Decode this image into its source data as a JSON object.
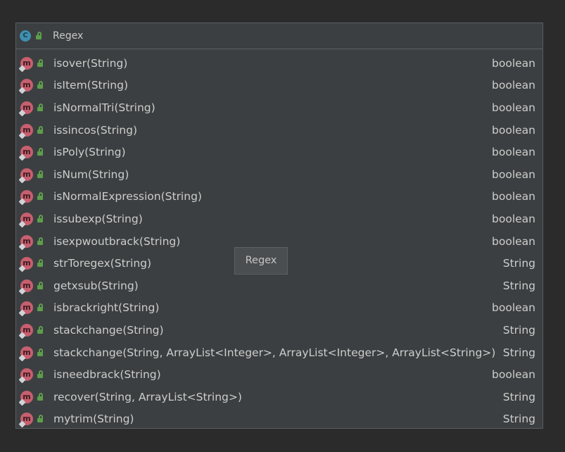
{
  "class": {
    "icon_letter": "C",
    "name": "Regex"
  },
  "tooltip": "Regex",
  "methods": [
    {
      "name": "isover(String)",
      "type": "boolean"
    },
    {
      "name": "isItem(String)",
      "type": "boolean"
    },
    {
      "name": "isNormalTri(String)",
      "type": "boolean"
    },
    {
      "name": "issincos(String)",
      "type": "boolean"
    },
    {
      "name": "isPoly(String)",
      "type": "boolean"
    },
    {
      "name": "isNum(String)",
      "type": "boolean"
    },
    {
      "name": "isNormalExpression(String)",
      "type": "boolean"
    },
    {
      "name": "issubexp(String)",
      "type": "boolean"
    },
    {
      "name": "isexpwoutbrack(String)",
      "type": "boolean"
    },
    {
      "name": "strToregex(String)",
      "type": "String"
    },
    {
      "name": "getxsub(String)",
      "type": "String"
    },
    {
      "name": "isbrackright(String)",
      "type": "boolean"
    },
    {
      "name": "stackchange(String)",
      "type": "String"
    },
    {
      "name": "stackchange(String, ArrayList<Integer>, ArrayList<Integer>, ArrayList<String>)",
      "type": "String"
    },
    {
      "name": "isneedbrack(String)",
      "type": "boolean"
    },
    {
      "name": "recover(String, ArrayList<String>)",
      "type": "String"
    },
    {
      "name": "mytrim(String)",
      "type": "String"
    }
  ],
  "method_icon_letter": "m",
  "colors": {
    "background": "#2b2b2b",
    "panel": "#3c3f41",
    "class_icon": "#3f8fae",
    "method_icon": "#c75f6f",
    "public_lock": "#5c9e4b"
  }
}
